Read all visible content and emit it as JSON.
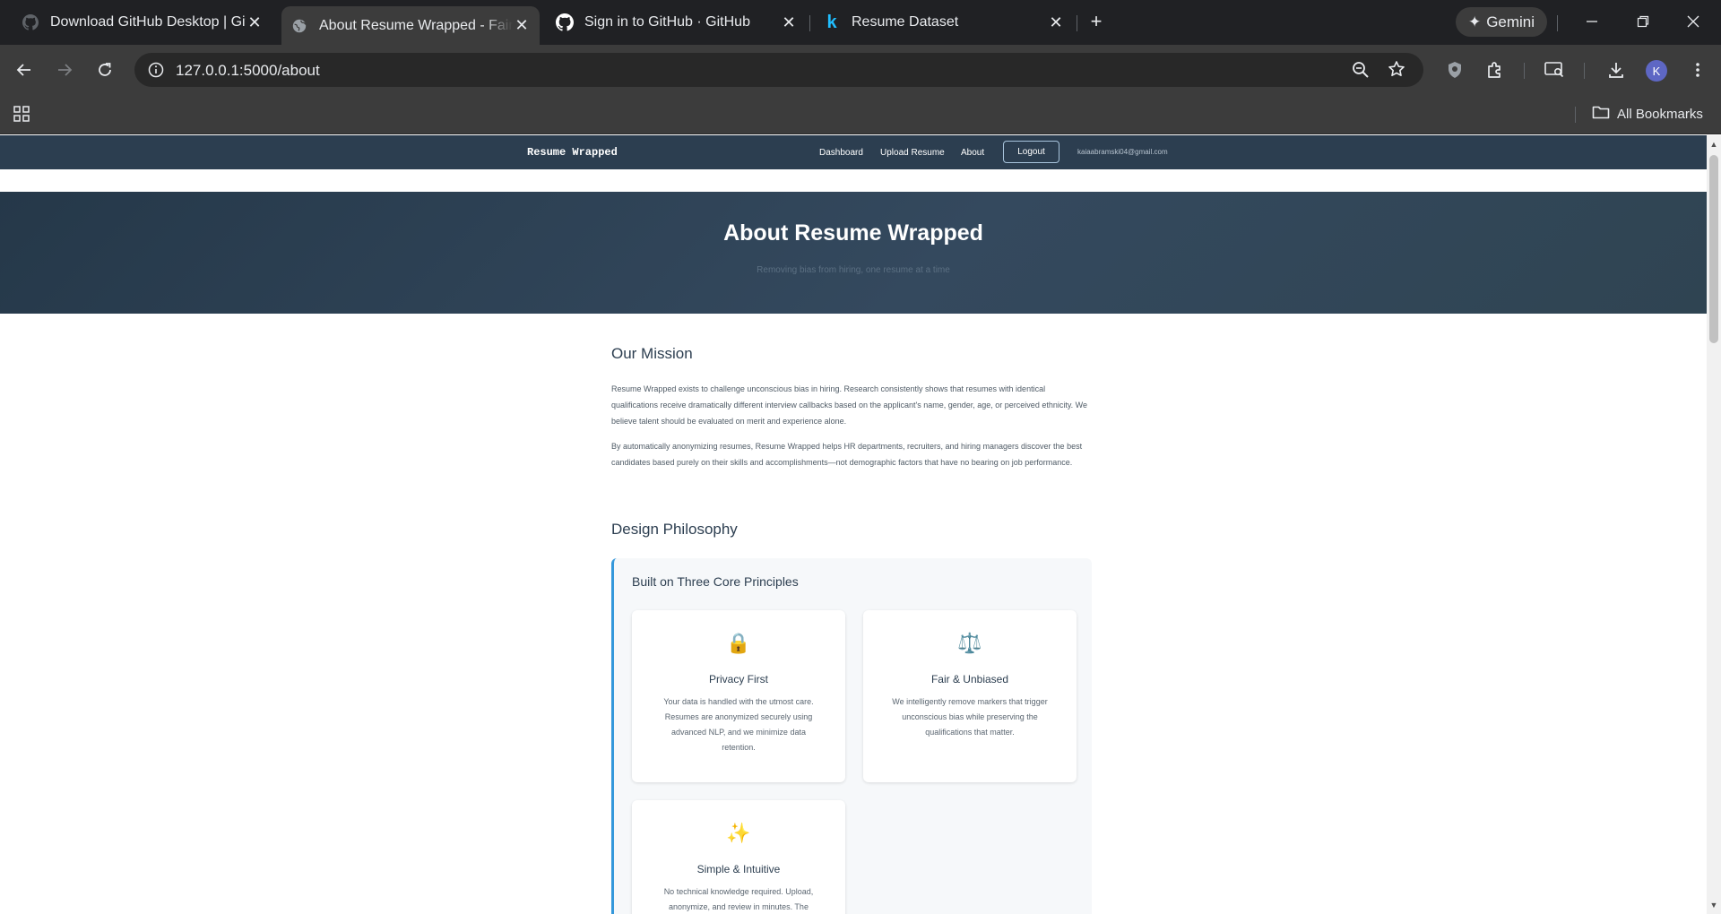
{
  "browser": {
    "tabs": [
      {
        "title": "Download GitHub Desktop | Git",
        "icon": "github-icon"
      },
      {
        "title": "About Resume Wrapped - Fair H",
        "icon": "globe-icon",
        "active": true
      },
      {
        "title": "Sign in to GitHub · GitHub",
        "icon": "github-icon"
      },
      {
        "title": "Resume Dataset",
        "icon": "kaggle-icon"
      }
    ],
    "gemini_label": "Gemini",
    "url": "127.0.0.1:5000/about",
    "profile_initial": "K",
    "all_bookmarks_label": "All Bookmarks"
  },
  "site": {
    "brand": "Resume Wrapped",
    "nav": {
      "dashboard": "Dashboard",
      "upload": "Upload Resume",
      "about": "About",
      "logout": "Logout",
      "email": "kaiaabramski04@gmail.com"
    },
    "hero": {
      "title": "About Resume Wrapped",
      "subtitle": "Removing bias from hiring, one resume at a time"
    },
    "mission": {
      "title": "Our Mission",
      "p1": "Resume Wrapped exists to challenge unconscious bias in hiring. Research consistently shows that resumes with identical qualifications receive dramatically different interview callbacks based on the applicant's name, gender, age, or perceived ethnicity. We believe talent should be evaluated on merit and experience alone.",
      "p2": "By automatically anonymizing resumes, Resume Wrapped helps HR departments, recruiters, and hiring managers discover the best candidates based purely on their skills and accomplishments—not demographic factors that have no bearing on job performance."
    },
    "philosophy": {
      "title": "Design Philosophy",
      "subtitle": "Built on Three Core Principles",
      "cards": [
        {
          "emoji": "🔒",
          "icon": "lock-icon",
          "title": "Privacy First",
          "desc": "Your data is handled with the utmost care. Resumes are anonymized securely using advanced NLP, and we minimize data retention."
        },
        {
          "emoji": "⚖️",
          "icon": "scales-icon",
          "title": "Fair & Unbiased",
          "desc": "We intelligently remove markers that trigger unconscious bias while preserving the qualifications that matter."
        },
        {
          "emoji": "✨",
          "icon": "sparkles-icon",
          "title": "Simple & Intuitive",
          "desc": "No technical knowledge required. Upload, anonymize, and review in minutes. The process"
        }
      ]
    }
  }
}
